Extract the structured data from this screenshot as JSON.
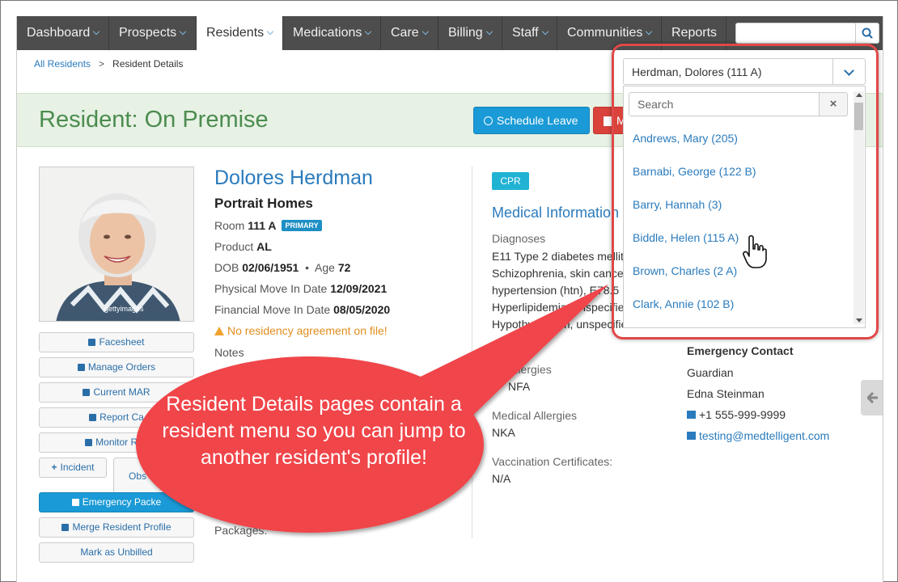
{
  "nav": {
    "items": [
      {
        "label": "Dashboard",
        "caret": true
      },
      {
        "label": "Prospects",
        "caret": true
      },
      {
        "label": "Residents",
        "caret": true,
        "active": true
      },
      {
        "label": "Medications",
        "caret": true
      },
      {
        "label": "Care",
        "caret": true
      },
      {
        "label": "Billing",
        "caret": true
      },
      {
        "label": "Staff",
        "caret": true
      },
      {
        "label": "Communities",
        "caret": true
      },
      {
        "label": "Reports",
        "caret": false
      }
    ],
    "search_icon": "search-icon"
  },
  "breadcrumb": {
    "root": "All Residents",
    "current": "Resident Details"
  },
  "status": {
    "title": "Resident: On Premise",
    "schedule_leave": "Schedule Leave",
    "red_button": "M"
  },
  "resident": {
    "name": "Dolores Herdman",
    "home": "Portrait Homes",
    "room_label": "Room",
    "room": "111 A",
    "room_badge": "PRIMARY",
    "product_label": "Product",
    "product": "AL",
    "dob_label": "DOB",
    "dob": "02/06/1951",
    "age_label": "Age",
    "age": "72",
    "physical_label": "Physical Move In Date",
    "physical": "12/09/2021",
    "financial_label": "Financial Move In Date",
    "financial": "08/05/2020",
    "warning": "No residency agreement on file!",
    "notes_label": "Notes",
    "packages_label": "Packages:",
    "photo_watermark": "gettyimages"
  },
  "side_buttons": {
    "facesheet": "Facesheet",
    "manage_orders": "Manage Orders",
    "current_mar": "Current MAR",
    "report_card": "Report Ca",
    "monitor": "Monitor Res",
    "incident": "Incident",
    "observation": "Obs",
    "emergency": "Emergency Packe",
    "merge": "Merge Resident Profile",
    "unbilled": "Mark as Unbilled"
  },
  "medical": {
    "badge": "CPR",
    "title": "Medical Information",
    "diagnoses_label": "Diagnoses",
    "diag_lines": [
      "E11 Type 2 diabetes mellit",
      "Schizophrenia, skin cance",
      "hypertension (htn), E78.5",
      "Hyperlipidemia, unspecifie",
      "Hypothyroidism, unspecifie"
    ],
    "food_label": "Allergies",
    "food_value": "NFA",
    "med_allergies_label": "Medical Allergies",
    "med_allergies_value": "NKA",
    "vacc_label": "Vaccination Certificates:",
    "vacc_value": "N/A"
  },
  "emergency_contact": {
    "title": "Emergency Contact",
    "relation": "Guardian",
    "name": "Edna Steinman",
    "phone": "+1 555-999-9999",
    "email": "testing@medtelligent.com"
  },
  "dropdown": {
    "selected": "Herdman, Dolores (111 A)",
    "search_placeholder": "Search",
    "options": [
      "Andrews, Mary (205)",
      "Barnabi, George (122 B)",
      "Barry, Hannah (3)",
      "Biddle, Helen (115 A)",
      "Brown, Charles (2 A)",
      "Clark, Annie (102 B)"
    ]
  },
  "callout": {
    "text": "Resident Details pages contain a resident menu so you can jump to another resident's profile!"
  },
  "colors": {
    "nav_bg": "#4d4d4d",
    "accent_blue": "#1a9ad6",
    "status_green": "#4b8c4f",
    "callout_red": "#f0454a",
    "highlight_red": "#e04848"
  }
}
